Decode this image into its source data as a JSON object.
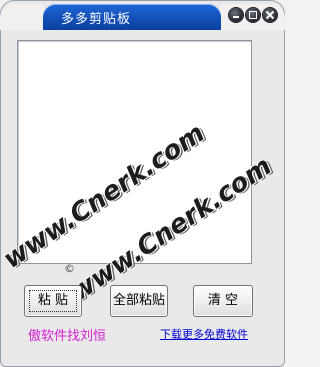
{
  "window": {
    "title": "多多剪贴板",
    "controls": {
      "minimize_icon": "minimize-icon",
      "maximize_icon": "maximize-icon",
      "close_icon": "close-icon"
    },
    "title_color": "#1a5fd0"
  },
  "content": {
    "text_value": ""
  },
  "watermark": {
    "line1": "www.Cnerk.com",
    "line2": "www.Cnerk.com",
    "mark": "©"
  },
  "buttons": {
    "paste": "粘 贴",
    "paste_all": "全部粘贴",
    "clear": "清 空"
  },
  "footer": {
    "author_text": "傲软件找刘恒",
    "download_link": "下载更多免费软件",
    "author_color": "#d21fd2",
    "link_color": "#0000d0"
  }
}
